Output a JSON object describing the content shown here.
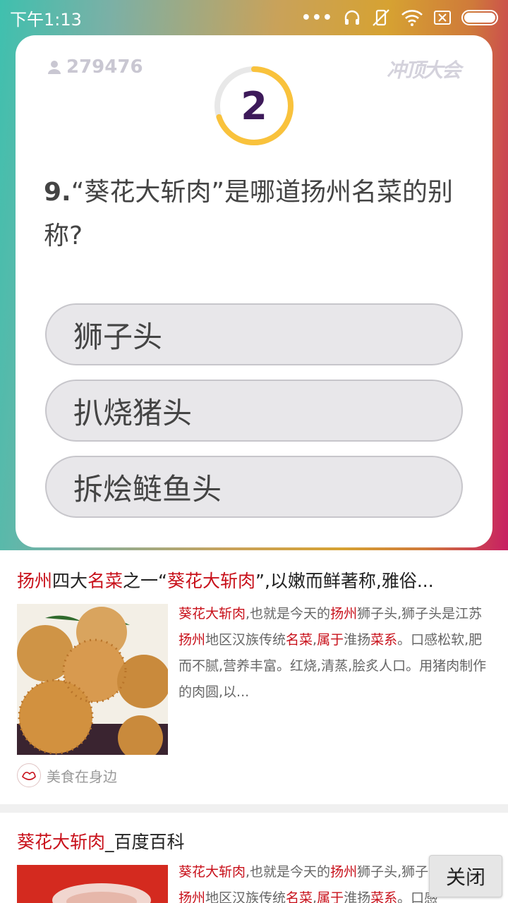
{
  "status_bar": {
    "time": "下午1:13",
    "icons": [
      "more-dots-icon",
      "headset-icon",
      "vibrate-off-icon",
      "wifi-icon",
      "sim-x-icon",
      "battery-icon"
    ]
  },
  "quiz": {
    "player_count": "279476",
    "logo_text": "冲顶大会",
    "timer_value": "2",
    "timer_progress": 0.7,
    "question_number": "9.",
    "question_text": "“葵花大斩肉”是哪道扬州名菜的别称?",
    "options": [
      "狮子头",
      "扒烧猪头",
      "拆烩鲢鱼头"
    ]
  },
  "colors": {
    "accent_yellow": "#f9c23c",
    "timer_track": "#e8e8e8",
    "highlight_red": "#c8101a",
    "timer_text": "#3d1a5a"
  },
  "results": [
    {
      "title_parts": [
        {
          "text": "扬州",
          "hl": true
        },
        {
          "text": "四大",
          "hl": false
        },
        {
          "text": "名菜",
          "hl": true
        },
        {
          "text": "之一“",
          "hl": false
        },
        {
          "text": "葵花大斩肉",
          "hl": true
        },
        {
          "text": "”,以嫩而鲜著称,雅俗...",
          "hl": false
        }
      ],
      "snippet_parts": [
        {
          "text": "葵花大斩肉",
          "hl": true
        },
        {
          "text": ",也就是今天的",
          "hl": false
        },
        {
          "text": "扬州",
          "hl": true
        },
        {
          "text": "狮子头,狮子头是江苏",
          "hl": false
        },
        {
          "text": "扬州",
          "hl": true
        },
        {
          "text": "地区汉族传统",
          "hl": false
        },
        {
          "text": "名菜",
          "hl": true
        },
        {
          "text": ",",
          "hl": false
        },
        {
          "text": "属于",
          "hl": true
        },
        {
          "text": "淮扬",
          "hl": false
        },
        {
          "text": "菜系",
          "hl": true
        },
        {
          "text": "。口感松软,肥而不腻,营养丰富。红烧,清蒸,脍炙人口。用猪肉制作的肉圆,以...",
          "hl": false
        }
      ],
      "source": "美食在身边"
    },
    {
      "title_parts": [
        {
          "text": "葵花大斩肉",
          "hl": true
        },
        {
          "text": "_百度百科",
          "hl": false
        }
      ],
      "snippet_parts": [
        {
          "text": "葵花大斩肉",
          "hl": true
        },
        {
          "text": ",也就是今天的",
          "hl": false
        },
        {
          "text": "扬州",
          "hl": true
        },
        {
          "text": "狮子头,狮子头是江苏",
          "hl": false
        },
        {
          "text": "扬州",
          "hl": true
        },
        {
          "text": "地区汉族传统",
          "hl": false
        },
        {
          "text": "名菜",
          "hl": true
        },
        {
          "text": ",",
          "hl": false
        },
        {
          "text": "属于",
          "hl": true
        },
        {
          "text": "淮扬",
          "hl": false
        },
        {
          "text": "菜系",
          "hl": true
        },
        {
          "text": "。口感",
          "hl": false
        }
      ]
    }
  ],
  "close_button": "关闭"
}
